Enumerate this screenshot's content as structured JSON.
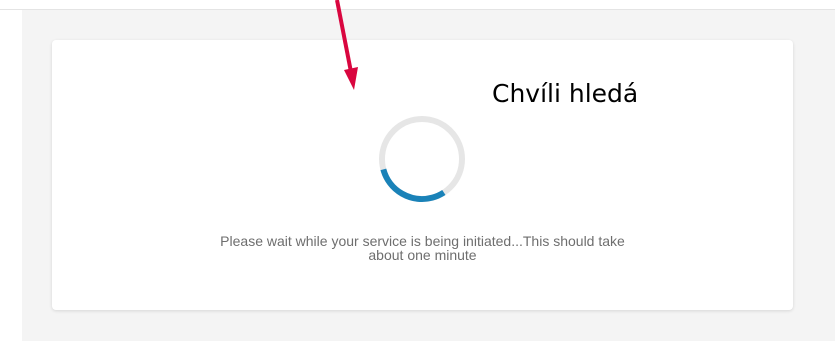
{
  "loading_card": {
    "message": "Please wait while your service is being initiated...This should take\nabout one minute",
    "spinner_progress": 0.3
  },
  "annotation": {
    "label": "Chvíli hledá"
  },
  "colors": {
    "spinner_active": "#1a82b8",
    "spinner_track": "#e6e6e6",
    "annotation_arrow": "#d9063f",
    "page_background": "#f4f4f4",
    "message_text": "#6e6e6e"
  },
  "icons": {
    "spinner": "loading-spinner-icon",
    "arrow": "arrow-down-icon"
  }
}
